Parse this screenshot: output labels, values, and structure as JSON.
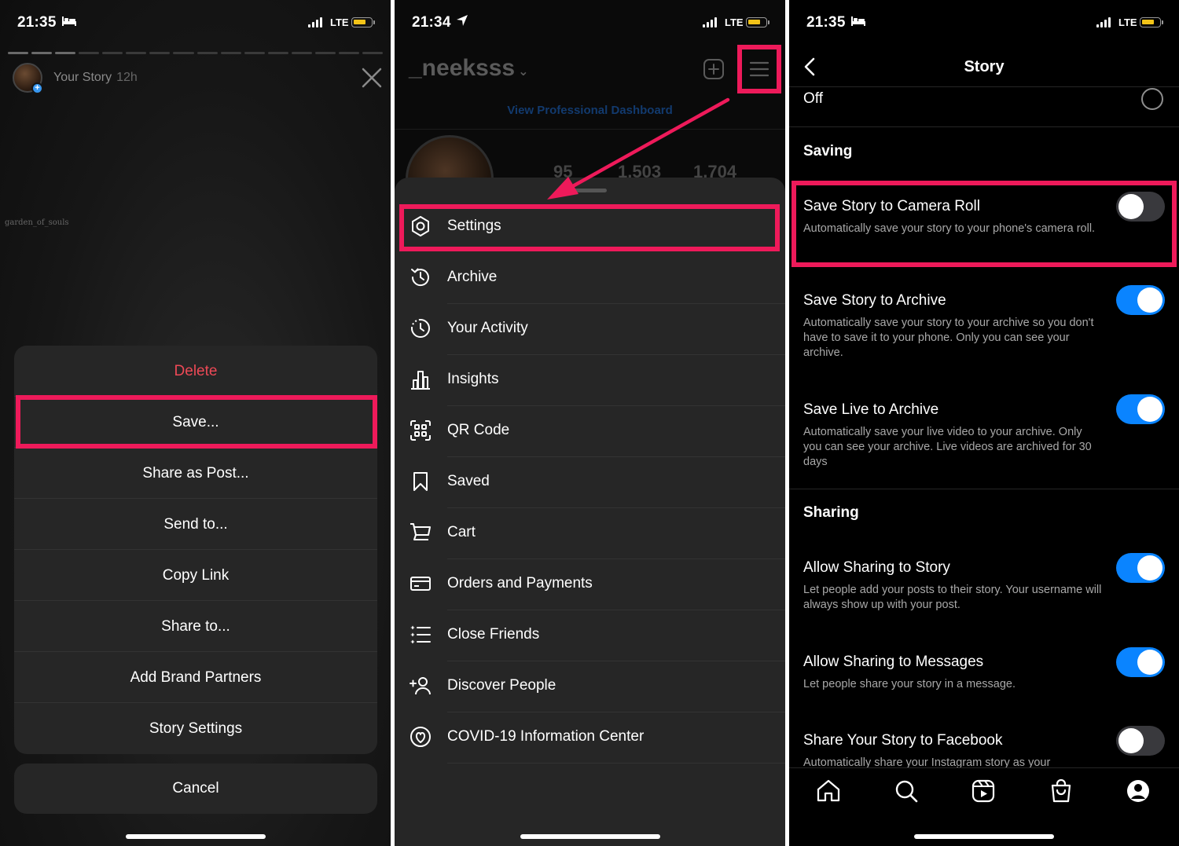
{
  "status_bars": [
    {
      "time": "21:35",
      "network": "LTE"
    },
    {
      "time": "21:34",
      "network": "LTE"
    },
    {
      "time": "21:35",
      "network": "LTE"
    }
  ],
  "story_view": {
    "user_label": "Your Story",
    "age": "12h",
    "watermark": "garden_of_souls",
    "sheet_items": [
      "Delete",
      "Save...",
      "Share as Post...",
      "Send to...",
      "Copy Link",
      "Share to...",
      "Add Brand Partners",
      "Story Settings"
    ],
    "cancel_label": "Cancel"
  },
  "profile_menu": {
    "username": "_neeksss",
    "dashboard_link": "View Professional Dashboard",
    "stats": [
      "95",
      "1,503",
      "1,704"
    ],
    "items": [
      {
        "label": "Settings",
        "icon": "settings-icon"
      },
      {
        "label": "Archive",
        "icon": "archive-icon"
      },
      {
        "label": "Your Activity",
        "icon": "activity-icon"
      },
      {
        "label": "Insights",
        "icon": "insights-icon"
      },
      {
        "label": "QR Code",
        "icon": "qr-code-icon"
      },
      {
        "label": "Saved",
        "icon": "bookmark-icon"
      },
      {
        "label": "Cart",
        "icon": "cart-icon"
      },
      {
        "label": "Orders and Payments",
        "icon": "card-icon"
      },
      {
        "label": "Close Friends",
        "icon": "close-friends-icon"
      },
      {
        "label": "Discover People",
        "icon": "add-person-icon"
      },
      {
        "label": "COVID-19 Information Center",
        "icon": "covid-info-icon"
      }
    ]
  },
  "story_settings": {
    "title": "Story",
    "off_label": "Off",
    "section_saving": "Saving",
    "section_sharing": "Sharing",
    "settings": [
      {
        "title": "Save Story to Camera Roll",
        "desc": "Automatically save your story to your phone's camera roll.",
        "on": false
      },
      {
        "title": "Save Story to Archive",
        "desc": "Automatically save your story to your archive so you don't have to save it to your phone. Only you can see your archive.",
        "on": true
      },
      {
        "title": "Save Live to Archive",
        "desc": "Automatically save your live video to your archive. Only you can see your archive. Live videos are archived for 30 days",
        "on": true
      },
      {
        "title": "Allow Sharing to Story",
        "desc": "Let people add your posts to their story. Your username will always show up with your post.",
        "on": true
      },
      {
        "title": "Allow Sharing to Messages",
        "desc": "Let people share your story in a message.",
        "on": true
      },
      {
        "title": "Share Your Story to Facebook",
        "desc": "Automatically share your Instagram story as your",
        "on": false
      }
    ]
  },
  "colors": {
    "highlight": "#ee1a5a",
    "toggle_on": "#0a84ff",
    "danger": "#ed4956",
    "battery": "#f2c318"
  }
}
